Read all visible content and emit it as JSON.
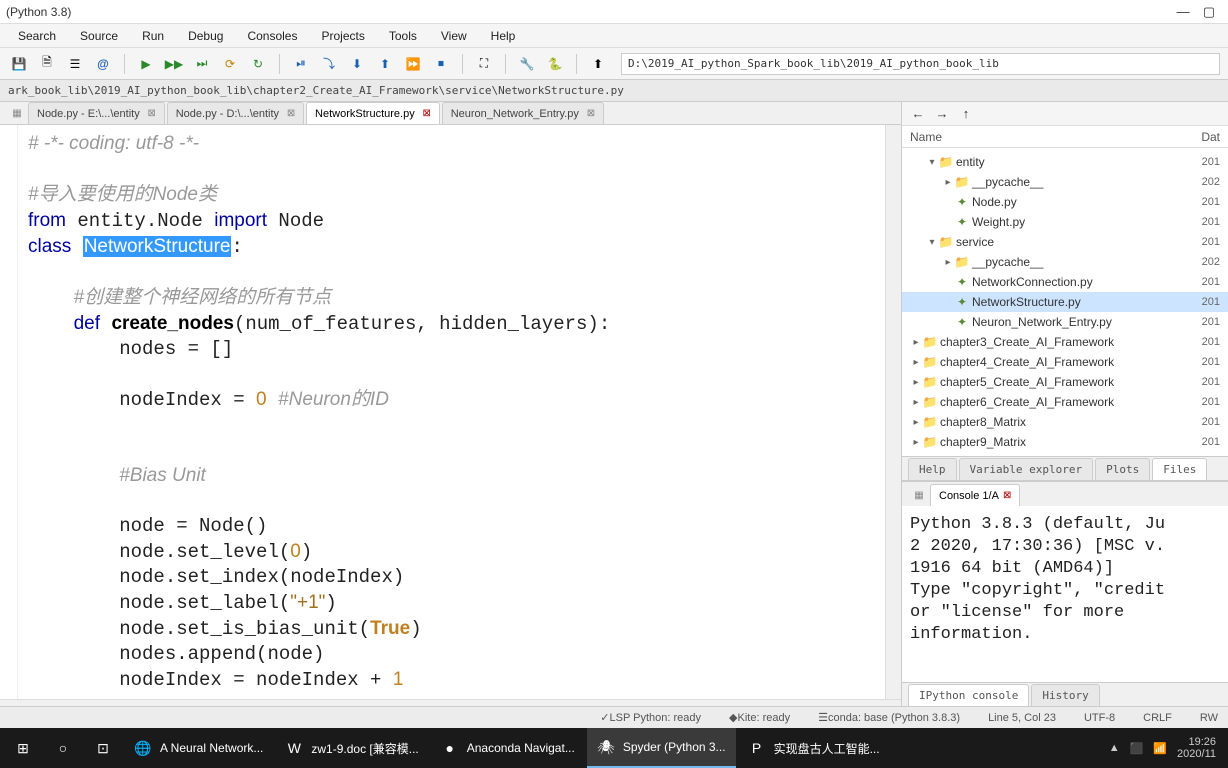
{
  "window": {
    "title": "(Python 3.8)"
  },
  "menu": [
    "Search",
    "Source",
    "Run",
    "Debug",
    "Consoles",
    "Projects",
    "Tools",
    "View",
    "Help"
  ],
  "path": "D:\\2019_AI_python_Spark_book_lib\\2019_AI_python_book_lib",
  "breadcrumb": "ark_book_lib\\2019_AI_python_book_lib\\chapter2_Create_AI_Framework\\service\\NetworkStructure.py",
  "tabs": [
    {
      "label": "Node.py - E:\\...\\entity",
      "active": false,
      "close": true
    },
    {
      "label": "Node.py - D:\\...\\entity",
      "active": false,
      "close": true
    },
    {
      "label": "NetworkStructure.py",
      "active": true,
      "close": true
    },
    {
      "label": "Neuron_Network_Entry.py",
      "active": false,
      "close": true
    }
  ],
  "file_explorer": {
    "headers": {
      "name": "Name",
      "date": "Dat"
    },
    "rows": [
      {
        "indent": 1,
        "chev": "▾",
        "ico": "📁",
        "label": "entity",
        "date": "201"
      },
      {
        "indent": 2,
        "chev": "▸",
        "ico": "📁",
        "label": "__pycache__",
        "date": "202"
      },
      {
        "indent": 2,
        "chev": "",
        "ico": "🐍",
        "label": "Node.py",
        "date": "201"
      },
      {
        "indent": 2,
        "chev": "",
        "ico": "🐍",
        "label": "Weight.py",
        "date": "201"
      },
      {
        "indent": 1,
        "chev": "▾",
        "ico": "📁",
        "label": "service",
        "date": "201"
      },
      {
        "indent": 2,
        "chev": "▸",
        "ico": "📁",
        "label": "__pycache__",
        "date": "202"
      },
      {
        "indent": 2,
        "chev": "",
        "ico": "🐍",
        "label": "NetworkConnection.py",
        "date": "201"
      },
      {
        "indent": 2,
        "chev": "",
        "ico": "🐍",
        "label": "NetworkStructure.py",
        "date": "201",
        "selected": true
      },
      {
        "indent": 2,
        "chev": "",
        "ico": "🐍",
        "label": "Neuron_Network_Entry.py",
        "date": "201"
      },
      {
        "indent": 0,
        "chev": "▸",
        "ico": "📁",
        "label": "chapter3_Create_AI_Framework",
        "date": "201"
      },
      {
        "indent": 0,
        "chev": "▸",
        "ico": "📁",
        "label": "chapter4_Create_AI_Framework",
        "date": "201"
      },
      {
        "indent": 0,
        "chev": "▸",
        "ico": "📁",
        "label": "chapter5_Create_AI_Framework",
        "date": "201"
      },
      {
        "indent": 0,
        "chev": "▸",
        "ico": "📁",
        "label": "chapter6_Create_AI_Framework",
        "date": "201"
      },
      {
        "indent": 0,
        "chev": "▸",
        "ico": "📁",
        "label": "chapter8_Matrix",
        "date": "201"
      },
      {
        "indent": 0,
        "chev": "▸",
        "ico": "📁",
        "label": "chapter9_Matrix",
        "date": "201"
      }
    ]
  },
  "help_tabs": [
    "Help",
    "Variable explorer",
    "Plots",
    "Files"
  ],
  "help_active": 3,
  "console_tab": "Console 1/A",
  "console_text": "Python 3.8.3 (default, Ju\n2 2020, 17:30:36) [MSC v.\n1916 64 bit (AMD64)]\nType \"copyright\", \"credit\nor \"license\" for more\ninformation.",
  "console_bottom_tabs": [
    "IPython console",
    "History"
  ],
  "status": {
    "lsp": "LSP Python: ready",
    "kite": "Kite: ready",
    "conda": "conda: base (Python 3.8.3)",
    "pos": "Line 5, Col 23",
    "enc": "UTF-8",
    "eol": "CRLF",
    "mode": "RW"
  },
  "taskbar": [
    {
      "ico": "⊞",
      "label": ""
    },
    {
      "ico": "○",
      "label": ""
    },
    {
      "ico": "⊡",
      "label": ""
    },
    {
      "ico": "🌐",
      "label": "A Neural Network..."
    },
    {
      "ico": "W",
      "label": "zw1-9.doc [兼容模..."
    },
    {
      "ico": "●",
      "label": "Anaconda Navigat..."
    },
    {
      "ico": "🕷",
      "label": "Spyder (Python 3...",
      "active": true
    },
    {
      "ico": "P",
      "label": "实现盘古人工智能..."
    }
  ],
  "clock": "19:26",
  "date": "2020/11"
}
